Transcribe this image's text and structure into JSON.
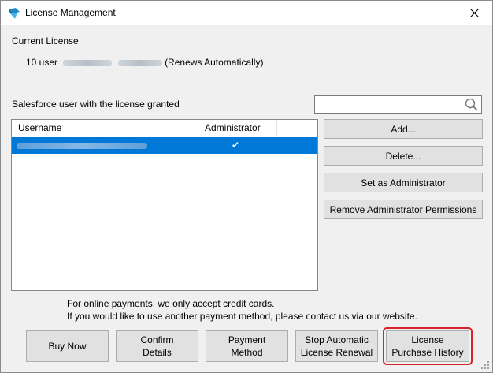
{
  "window": {
    "title": "License Management",
    "close_symbol": "✕"
  },
  "current_license": {
    "heading": "Current License",
    "prefix": "10 user",
    "suffix": "(Renews Automatically)"
  },
  "users_section": {
    "label": "Salesforce user with the license granted",
    "search_placeholder": ""
  },
  "table": {
    "columns": [
      "Username",
      "Administrator"
    ],
    "rows": [
      {
        "username": "",
        "administrator": "✔",
        "selected": true
      }
    ]
  },
  "side_buttons": {
    "add": "Add...",
    "delete": "Delete...",
    "set_admin": "Set as Administrator",
    "remove_admin": "Remove Administrator Permissions"
  },
  "payment_note": {
    "line1": "For online payments, we only accept credit cards.",
    "line2": "If you would like to use another payment method, please contact us via our website."
  },
  "bottom_buttons": {
    "buy_now": "Buy Now",
    "confirm_details": "Confirm\nDetails",
    "payment_method": "Payment\nMethod",
    "stop_renewal": "Stop  Automatic\nLicense Renewal",
    "purchase_history": "License\nPurchase History"
  },
  "colors": {
    "selection": "#0078d7",
    "highlight_outline": "#d9232e"
  }
}
